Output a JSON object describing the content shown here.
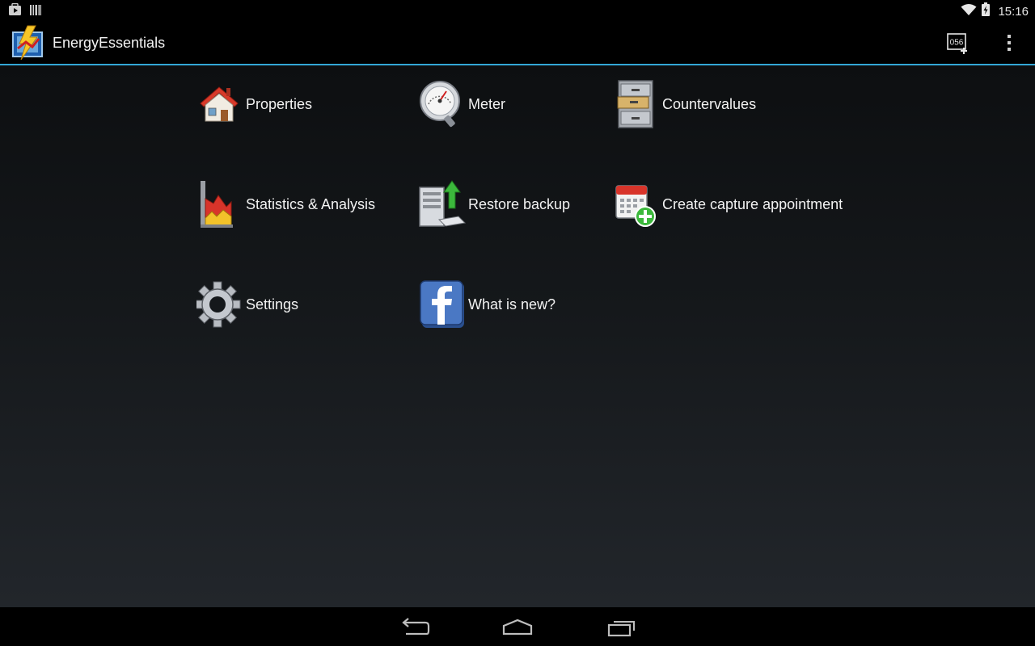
{
  "status_bar": {
    "time": "15:16"
  },
  "action_bar": {
    "title": "EnergyEssentials",
    "add_reading_badge": "056"
  },
  "menu": [
    {
      "label": "Properties",
      "icon": "house-icon"
    },
    {
      "label": "Meter",
      "icon": "meter-gauge-icon"
    },
    {
      "label": "Countervalues",
      "icon": "filing-cabinet-icon"
    },
    {
      "label": "Statistics & Analysis",
      "icon": "chart-icon"
    },
    {
      "label": "Restore backup",
      "icon": "server-upload-icon"
    },
    {
      "label": "Create capture appointment",
      "icon": "calendar-add-icon"
    },
    {
      "label": "Settings",
      "icon": "gear-icon"
    },
    {
      "label": "What is new?",
      "icon": "facebook-icon"
    }
  ],
  "colors": {
    "accent": "#33a7d7",
    "background_top": "#0d0f11",
    "background_bottom": "#22262b"
  }
}
